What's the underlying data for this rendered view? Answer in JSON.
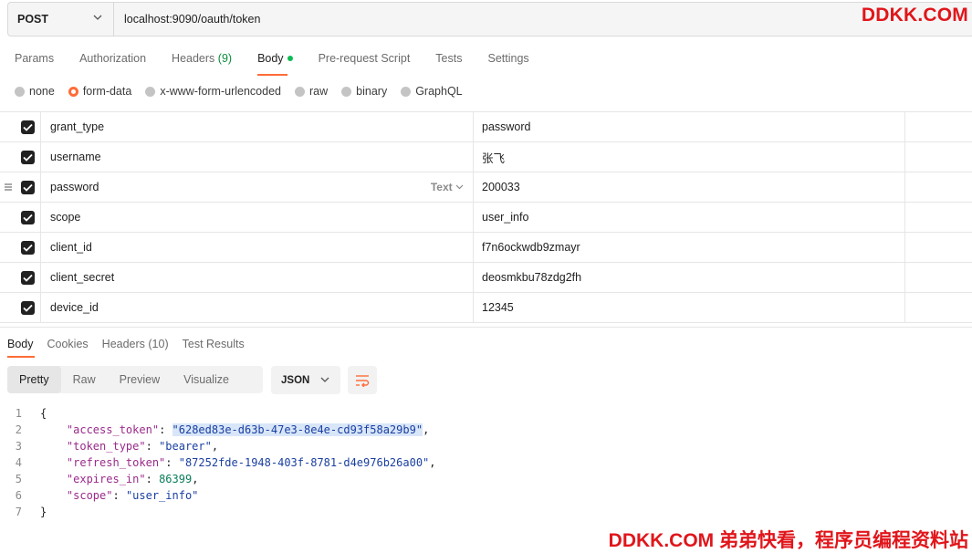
{
  "request": {
    "method": "POST",
    "url": "localhost:9090/oauth/token"
  },
  "watermarks": {
    "top": "DDKK.COM",
    "bottom": "DDKK.COM 弟弟快看，程序员编程资料站"
  },
  "tabs": [
    {
      "label": "Params"
    },
    {
      "label": "Authorization"
    },
    {
      "label": "Headers",
      "count": "(9)"
    },
    {
      "label": "Body"
    },
    {
      "label": "Pre-request Script"
    },
    {
      "label": "Tests"
    },
    {
      "label": "Settings"
    }
  ],
  "body_types": [
    "none",
    "form-data",
    "x-www-form-urlencoded",
    "raw",
    "binary",
    "GraphQL"
  ],
  "body_type_selected": "form-data",
  "form_rows": [
    {
      "key": "grant_type",
      "value": "password",
      "checked": true
    },
    {
      "key": "username",
      "value": "张飞",
      "checked": true
    },
    {
      "key": "password",
      "value": "200033",
      "checked": true,
      "type_label": "Text"
    },
    {
      "key": "scope",
      "value": "user_info",
      "checked": true
    },
    {
      "key": "client_id",
      "value": "f7n6ockwdb9zmayr",
      "checked": true
    },
    {
      "key": "client_secret",
      "value": "deosmkbu78zdg2fh",
      "checked": true
    },
    {
      "key": "device_id",
      "value": "12345",
      "checked": true
    }
  ],
  "response_tabs": [
    {
      "label": "Body"
    },
    {
      "label": "Cookies"
    },
    {
      "label": "Headers (10)"
    },
    {
      "label": "Test Results"
    }
  ],
  "view_modes": [
    "Pretty",
    "Raw",
    "Preview",
    "Visualize"
  ],
  "view_mode_selected": "Pretty",
  "format": "JSON",
  "response_json": {
    "open": "{",
    "close": "}",
    "lines": [
      {
        "key": "\"access_token\"",
        "value": "\"628ed83e-d63b-47e3-8e4e-cd93f58a29b9\"",
        "kind": "string",
        "comma": ","
      },
      {
        "key": "\"token_type\"",
        "value": "\"bearer\"",
        "kind": "string",
        "comma": ","
      },
      {
        "key": "\"refresh_token\"",
        "value": "\"87252fde-1948-403f-8781-d4e976b26a00\"",
        "kind": "string",
        "comma": ","
      },
      {
        "key": "\"expires_in\"",
        "value": "86399",
        "kind": "number",
        "comma": ","
      },
      {
        "key": "\"scope\"",
        "value": "\"user_info\"",
        "kind": "string",
        "comma": ""
      }
    ],
    "line_numbers": [
      "1",
      "2",
      "3",
      "4",
      "5",
      "6",
      "7"
    ]
  },
  "colors": {
    "accent": "#ff6c37",
    "watermark": "#e0161b",
    "body_dot": "#0cbb52"
  }
}
